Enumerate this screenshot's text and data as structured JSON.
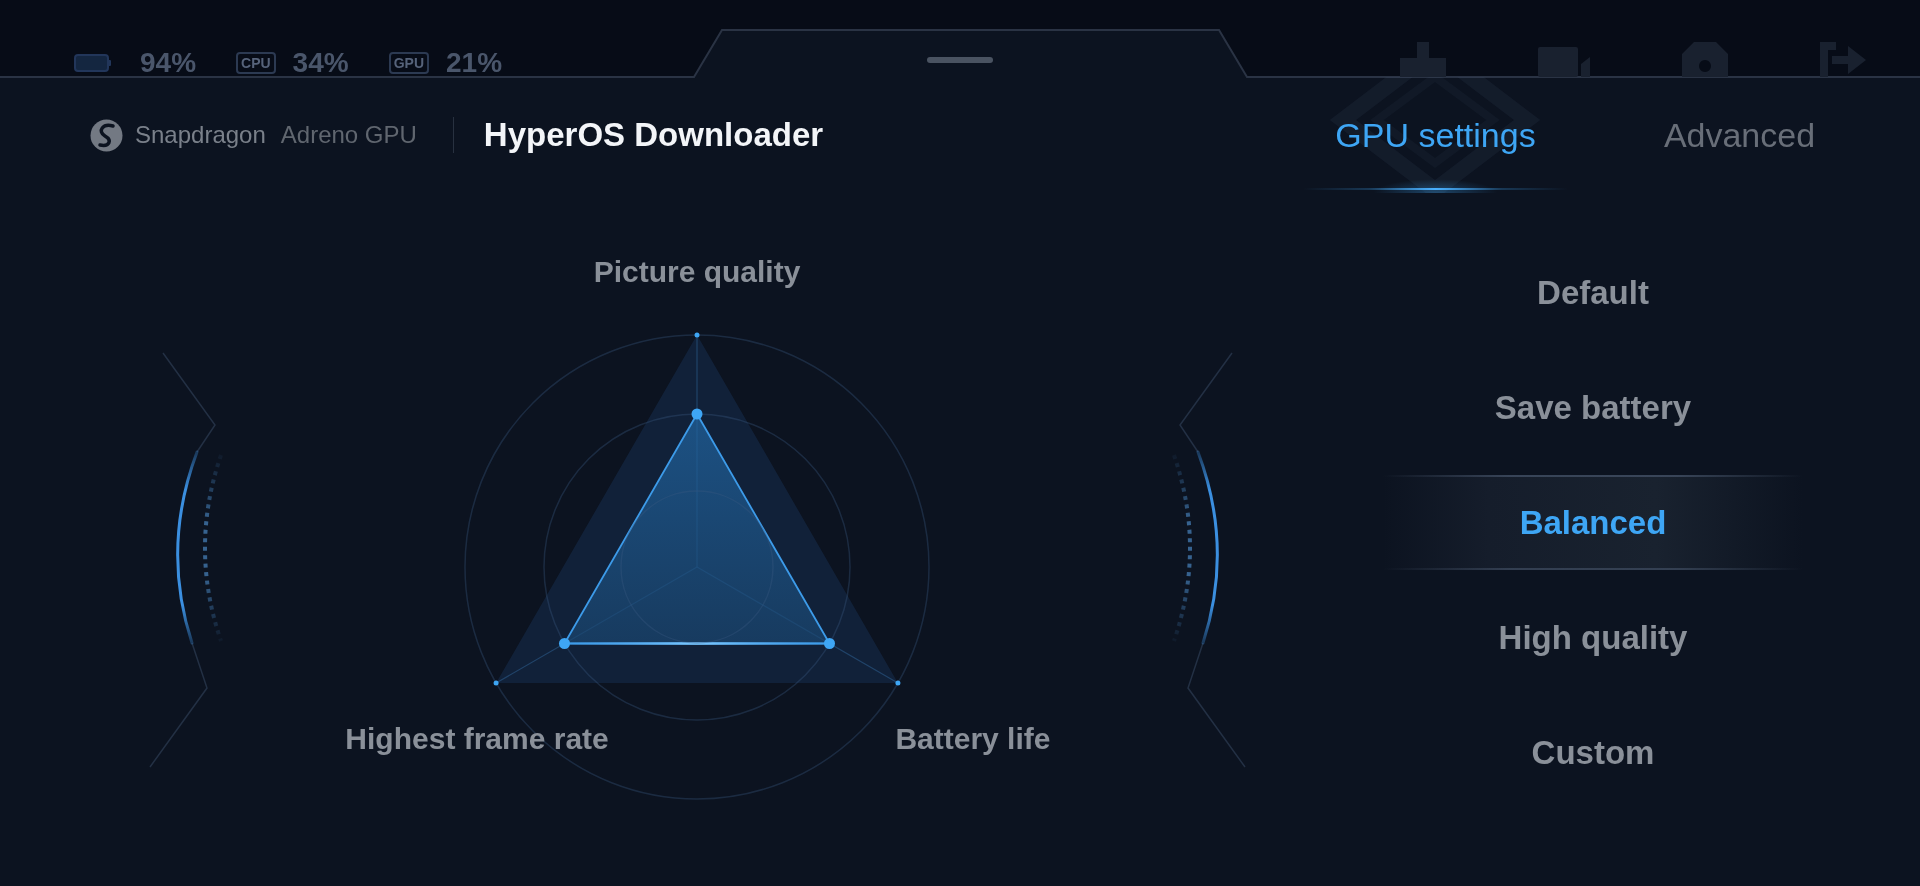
{
  "status_items": [
    {
      "kind": "battery",
      "value": "94%"
    },
    {
      "kind": "chip",
      "label": "CPU",
      "value": "34%"
    },
    {
      "kind": "chip",
      "label": "GPU",
      "value": "21%"
    }
  ],
  "header": {
    "brand": "Snapdragon",
    "product": "Adreno GPU",
    "title": "HyperOS Downloader"
  },
  "tabs": [
    {
      "label": "GPU settings",
      "selected": true
    },
    {
      "label": "Advanced",
      "selected": false
    }
  ],
  "radar": {
    "axes": [
      "Picture quality",
      "Highest frame rate",
      "Battery life"
    ]
  },
  "modes": [
    {
      "label": "Default",
      "selected": false
    },
    {
      "label": "Save battery",
      "selected": false
    },
    {
      "label": "Balanced",
      "selected": true
    },
    {
      "label": "High quality",
      "selected": false
    },
    {
      "label": "Custom",
      "selected": false
    }
  ]
}
